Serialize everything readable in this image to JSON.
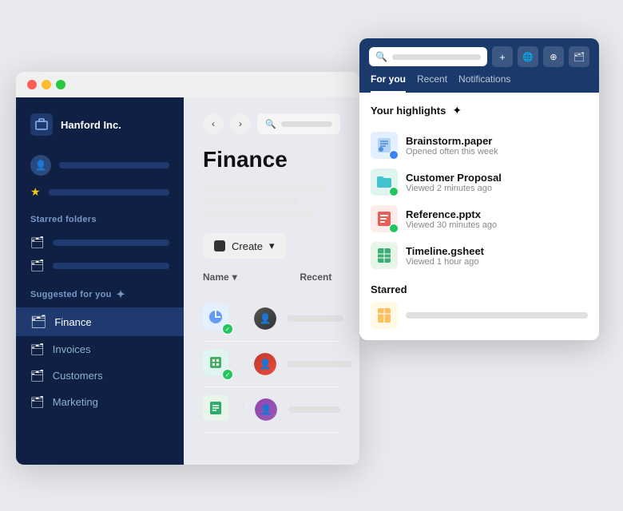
{
  "sidebar": {
    "company_name": "Hanford Inc.",
    "section_starred": "Starred folders",
    "section_suggested": "Suggested for you",
    "nav_items": [
      {
        "label": "Finance",
        "active": true
      },
      {
        "label": "Invoices",
        "active": false
      },
      {
        "label": "Customers",
        "active": false
      },
      {
        "label": "Marketing",
        "active": false
      }
    ]
  },
  "main": {
    "page_title": "Finance",
    "create_button": "Create",
    "table_headers": {
      "name": "Name",
      "recent": "Recent"
    }
  },
  "search_panel": {
    "tabs": [
      "For you",
      "Recent",
      "Notifications"
    ],
    "active_tab": "For you",
    "highlights_title": "Your highlights",
    "highlights": [
      {
        "name": "Brainstorm.paper",
        "sub": "Opened often this week",
        "type": "doc",
        "icon": "📄"
      },
      {
        "name": "Customer Proposal",
        "sub": "Viewed 2 minutes ago",
        "type": "folder",
        "icon": "📁"
      },
      {
        "name": "Reference.pptx",
        "sub": "Viewed 30 minutes ago",
        "type": "ppt",
        "icon": "📊"
      },
      {
        "name": "Timeline.gsheet",
        "sub": "Viewed 1 hour ago",
        "type": "sheet",
        "icon": "📗"
      }
    ],
    "starred_title": "Starred",
    "toolbar_icons": [
      "+",
      "🌍",
      "⊕",
      "🗂"
    ]
  }
}
